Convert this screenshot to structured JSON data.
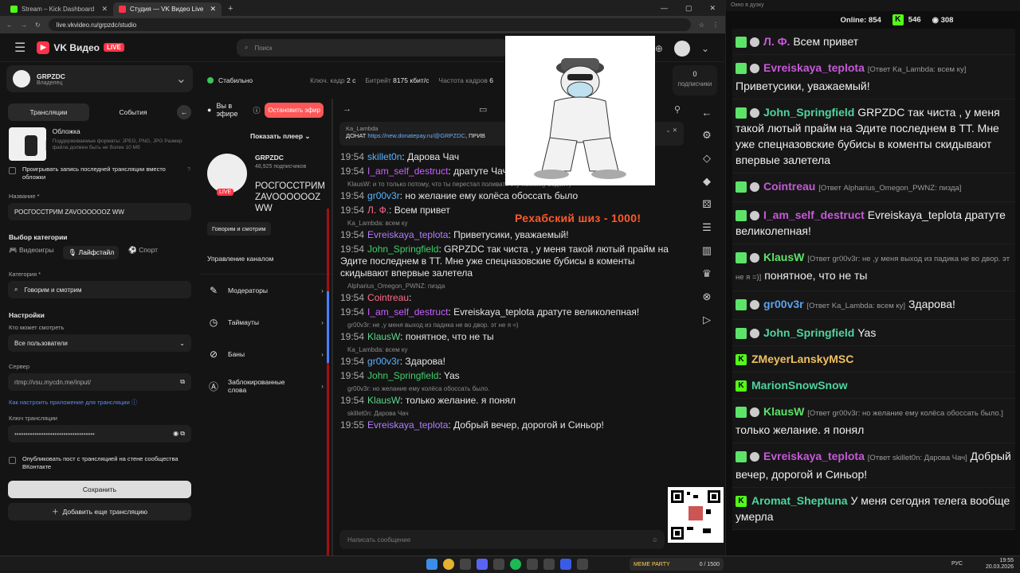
{
  "browser": {
    "tabs": [
      {
        "label": "Stream – Kick Dashboard",
        "color": "#53fc18"
      },
      {
        "label": "Студия — VK Видео Live",
        "color": "#ff3347"
      }
    ],
    "url": "live.vkvideo.ru/grpzdc/studio"
  },
  "header": {
    "logo": "VK Видео",
    "live_badge": "LIVE",
    "search_placeholder": "Поиск"
  },
  "left": {
    "channel_name": "GRPZDC",
    "channel_role": "Владелец",
    "tab_streams": "Трансляции",
    "tab_events": "События",
    "cover_title": "Обложка",
    "cover_desc": "Поддерживаемые форматы: JPEG, PNG, JPG Размер файла должен быть не более 10 Мб",
    "play_last": "Проигрывать запись последней трансляции вместо обложки",
    "name_label": "Название *",
    "name_value": "РОСГОССТРИМ ZAVOOOOOOZ WW",
    "category_select": "Выбор категории",
    "cats": [
      "Видеоигры",
      "Лайфстайл",
      "Спорт"
    ],
    "category_label": "Категория *",
    "category_value": "Говорим и смотрим",
    "settings": "Настройки",
    "who_label": "Кто может смотреть",
    "who_value": "Все пользователи",
    "server_label": "Сервер",
    "server_value": "rtmp://vsu.mycdn.me/input/",
    "howto_link": "Как настроить приложение для трансляции",
    "key_label": "Ключ трансляции",
    "key_value": "••••••••••••••••••••••••••••••••••••",
    "publish": "Опубликовать пост с трансляцией на стене сообщества ВКонтакте",
    "save": "Сохранить",
    "add": "Добавить еще трансляцию"
  },
  "stats": {
    "status": "Стабильно",
    "key_label": "Ключ. кадр",
    "key_value": "2 с",
    "bitrate_label": "Битрейт",
    "bitrate_value": "8175 кбит/с",
    "fps_label": "Частота кадров",
    "fps_value": "6",
    "subs_value": "0",
    "subs_label": "подписчики"
  },
  "mid": {
    "onair": "Вы в эфире",
    "stop": "Остановить эфир",
    "show_player": "Показать плеер",
    "channel": "GRPZDC",
    "subs": "48,925 подписчиков",
    "title": "РОСГОССТРИМ ZAVOOOOOOZ WW",
    "live": "LIVE",
    "tag": "Говорим и смотрим",
    "mgmt": "Управление каналом",
    "items": [
      "Модераторы",
      "Таймауты",
      "Баны",
      "Заблокированные слова"
    ]
  },
  "chat": {
    "pinned_user": "Ka_Lambda",
    "pinned_text": "ДОНАТ",
    "pinned_url": "https://new.donatepay.ru/@GRPZDC",
    "pinned_tail": ", ПРИВ",
    "input_placeholder": "Написать сообщение",
    "lines": [
      {
        "t": "19:54",
        "n": "skillet0n",
        "c": "n1",
        "m": "Дарова Чач"
      },
      {
        "t": "19:54",
        "n": "I_am_self_destruct",
        "c": "n2",
        "m": "дратуте Чач"
      },
      {
        "r": "KlausW: и то только потому, что ты перестал поливать эту помойку водой?)"
      },
      {
        "t": "19:54",
        "n": "gr00v3r",
        "c": "n1",
        "m": "но желание ему колёса обоссать было"
      },
      {
        "t": "19:54",
        "n": "Л. Ф.",
        "c": "n4",
        "m": "Всем привет"
      },
      {
        "r": "Ka_Lambda: всем ку"
      },
      {
        "t": "19:54",
        "n": "Evreiskaya_teplota",
        "c": "n5",
        "m": "Приветусики, уважаемый!"
      },
      {
        "t": "19:54",
        "n": "John_Springfield",
        "c": "n3",
        "m": "GRPZDC так чиста , у меня такой лютый прайм на Эдите последнем в ТТ. Мне уже спецназовские бубисы в коменты скидывают  впервые залетела"
      },
      {
        "r": "Alpharius_Omegon_PWNZ: пизда"
      },
      {
        "t": "19:54",
        "n": "Cointreau",
        "c": "n4",
        "m": ""
      },
      {
        "t": "19:54",
        "n": "I_am_self_destruct",
        "c": "n2",
        "m": "Evreiskaya_teplota дратуте великолепная!"
      },
      {
        "r": "gr00v3r: не ,у меня выход из падика не во двор. эт не я =)"
      },
      {
        "t": "19:54",
        "n": "KlausW",
        "c": "n6",
        "m": "понятное, что не ты"
      },
      {
        "r": "Ka_Lambda: всем ку"
      },
      {
        "t": "19:54",
        "n": "gr00v3r",
        "c": "n1",
        "m": "Здарова!"
      },
      {
        "t": "19:54",
        "n": "John_Springfield",
        "c": "n3",
        "m": "Yas"
      },
      {
        "r": "gr00v3r: но желание ему колёса обоссать было."
      },
      {
        "t": "19:54",
        "n": "KlausW",
        "c": "n6",
        "m": "только желание. я понял"
      },
      {
        "r": "skillet0n: Дарова Чач"
      },
      {
        "t": "19:55",
        "n": "Evreiskaya_teplota",
        "c": "n5",
        "m": "Добрый вечер, дорогой и Синьор!"
      }
    ]
  },
  "overlay": {
    "raffle": "Рехабский шиз - 1000!"
  },
  "right": {
    "title": "Окно в дуэку",
    "online_label": "Online:",
    "online": "854",
    "kick_count": "546",
    "vk_count": "308",
    "msgs": [
      {
        "n": "Л. Ф.",
        "c": "rpk",
        "m": "Всем привет",
        "b": "v"
      },
      {
        "n": "Evreiskaya_teplota",
        "c": "rpk",
        "rp": "[Ответ Ka_Lambda: всем ку]",
        "m": "Приветусики, уважаемый!",
        "b": "v"
      },
      {
        "n": "John_Springfield",
        "c": "rgr",
        "m": "GRPZDC так чиста , у меня такой лютый прайм на Эдите последнем в ТТ. Мне уже спецназовские бубисы в коменты скидывают  впервые  залетела",
        "b": "v"
      },
      {
        "n": "Cointreau",
        "c": "rpk",
        "rp": "[Ответ Alpharius_Omegon_PWNZ: пизда]",
        "m": "",
        "b": "v"
      },
      {
        "n": "I_am_self_destruct",
        "c": "rpk",
        "m": "Evreiskaya_teplota дратуте великолепная!",
        "b": "v"
      },
      {
        "n": "KlausW",
        "c": "rg",
        "rp": "[Ответ gr00v3r: не ,у меня выход из падика не во двор. эт не я =)]",
        "m": "понятное, что не ты",
        "b": "v"
      },
      {
        "n": "gr00v3r",
        "c": "rbl",
        "rp": "[Ответ Ka_Lambda: всем ку]",
        "m": "Здарова!",
        "b": "v"
      },
      {
        "n": "John_Springfield",
        "c": "rgr",
        "m": "Yas",
        "b": "v"
      },
      {
        "n": "ZMeyerLanskyMSC",
        "c": "ror",
        "m": "",
        "b": "k"
      },
      {
        "n": "MarionSnowSnow",
        "c": "rgr",
        "m": "",
        "b": "k"
      },
      {
        "n": "KlausW",
        "c": "rg",
        "rp": "[Ответ gr00v3r: но желание ему колёса обоссать было.]",
        "m": "только желание. я понял",
        "b": "v"
      },
      {
        "n": "Evreiskaya_teplota",
        "c": "rpk",
        "rp": "[Ответ skillet0n: Дарова Чач]",
        "m": "Добрый вечер, дорогой и Синьор!",
        "b": "v"
      },
      {
        "n": "Aromat_Sheptuna",
        "c": "rgr",
        "m": "У меня сегодня телега вообще умерла",
        "b": "k"
      }
    ]
  },
  "taskbar": {
    "lang": "РУС",
    "time": "19:55",
    "date": "20.03.2026",
    "meme_party": "MEME PARTY",
    "meme_count": "0 / 1500"
  }
}
